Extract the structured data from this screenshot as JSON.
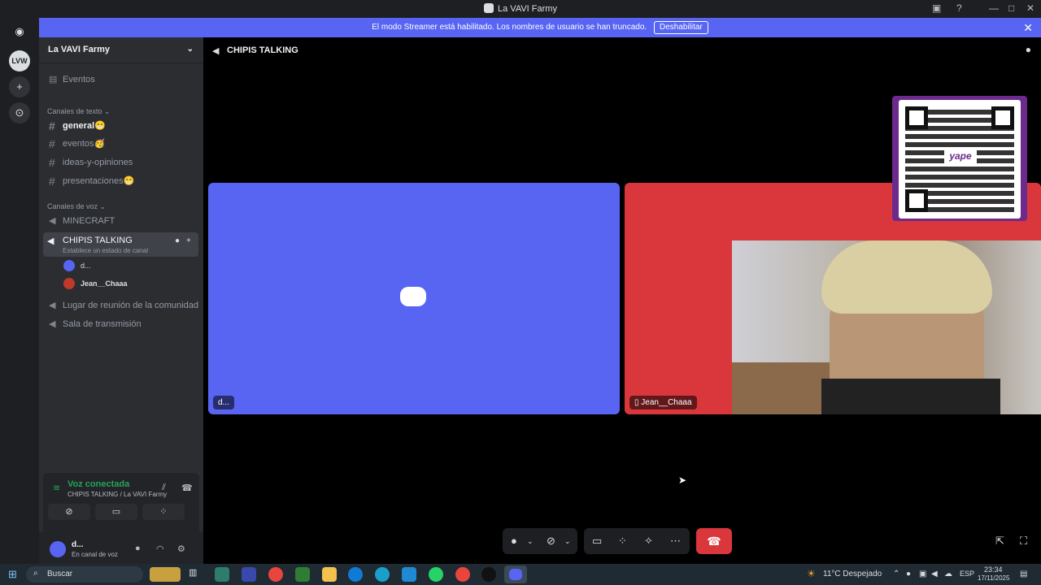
{
  "window": {
    "title": "La VAVI Farmy"
  },
  "banner": {
    "message": "El modo Streamer está habilitado. Los nombres de usuario se han truncado.",
    "button": "Deshabilitar"
  },
  "server": {
    "name": "La VAVI Farmy",
    "guild_initials": "LVW"
  },
  "sidebar": {
    "events": "Eventos",
    "text_category": "Canales de texto",
    "text_channels": [
      {
        "label": "general",
        "emoji": "😁"
      },
      {
        "label": "eventos",
        "emoji": "🥳"
      },
      {
        "label": "ideas-y-opiniones",
        "emoji": ""
      },
      {
        "label": "presentaciones",
        "emoji": "😁"
      }
    ],
    "voice_category": "Canales de voz",
    "voice_channels": [
      {
        "label": "MINECRAFT"
      },
      {
        "label": "CHIPIS TALKING",
        "status": "Establece un estado de canal"
      },
      {
        "label": "Lugar de reunión de la comunidad"
      },
      {
        "label": "Sala de transmisión"
      }
    ],
    "voice_users": [
      {
        "name": "d...",
        "color": "#5865f2"
      },
      {
        "name": "Jean__Chaaa",
        "color": "#c0392b"
      }
    ]
  },
  "voice_panel": {
    "status": "Voz conectada",
    "location": "CHIPIS TALKING / La VAVI Farmy"
  },
  "user": {
    "name": "d...",
    "status": "En canal de voz"
  },
  "stage": {
    "channel": "CHIPIS TALKING",
    "tiles": [
      {
        "name": "d...",
        "bg": "#5865f2"
      },
      {
        "name": "Jean__Chaaa",
        "bg": "#da373c"
      }
    ],
    "qr_label": "yape"
  },
  "taskbar": {
    "search": "Buscar",
    "weather": "11°C  Despejado",
    "lang": "ESP",
    "time": "23:34",
    "date": "17/11/2025"
  }
}
